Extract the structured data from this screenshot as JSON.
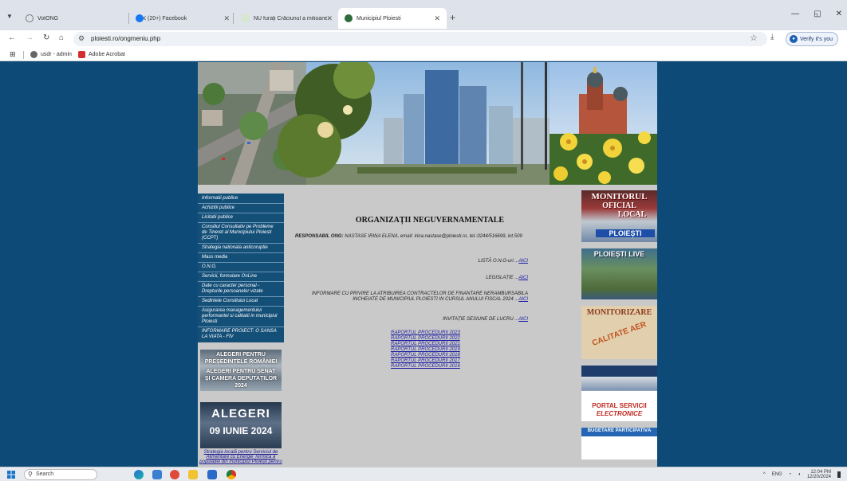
{
  "browser": {
    "tabs": [
      {
        "title": "VotONG",
        "active": false
      },
      {
        "title": "(20+) Facebook",
        "active": false
      },
      {
        "title": "NU furați Crăciunul a milioane",
        "active": false
      },
      {
        "title": "Municipiul Ploiesti",
        "active": true
      }
    ],
    "new_tab_label": "+",
    "url": "ploiesti.ro/ongmeniu.php",
    "verify_label": "Verify it's you",
    "bookmarks": [
      {
        "label": "usdr - admin"
      },
      {
        "label": "Adobe Acrobat"
      }
    ]
  },
  "site": {
    "menu": [
      "Informatii publice",
      "Achizitii publice",
      "Licitatii publice",
      "Consiliul Consultativ pe Probleme de Tineret al Municipiului Ploiesti (CCPT)",
      "Strategia nationala anticoruptie",
      "Mass media",
      "O.N.G.",
      "Servicii, formulare OnLine",
      "Date cu caracter personal - Drepturile persoanelor vizate",
      "Sedintele Consiliului Local",
      "Asigurarea managementului performantei si calitatii in municipiul Ploiesti",
      "INFORMARE PROIECT: O SANSA LA VIATA - FIV"
    ],
    "alegeri_banner": {
      "line1": "ALEGERI PENTRU",
      "line2": "PREȘEDINTELE ROMÂNIEI",
      "line3": "ALEGERI PENTRU SENAT",
      "line4": "ȘI CAMERA DEPUTAȚILOR",
      "line5": "2024"
    },
    "alegeri_iunie": {
      "line1": "ALEGERI",
      "line2": "09 IUNIE 2024"
    },
    "strategie_link": "Strategia locală pentru Serviciul de Alimentare cu Energie Termică a populației din municipiul Ploiești pentru",
    "title": "ORGANIZAȚII NEGUVERNAMENTALE",
    "responsabil_label": "RESPONSABIL ONG:",
    "responsabil_text": "NASTASE IRINA ELENA, email: irina.nastase@ploiesti.ro, tel.:0244/516699, int.509",
    "lines": [
      {
        "text": "LISTĂ O.N.G-uri ...",
        "link": "AICI"
      },
      {
        "text": "LEGISLAȚIE ...",
        "link": "AICI"
      },
      {
        "text": "INFORMARE CU PRIVIRE LA ATRIBUIREA CONTRACTELOR DE FINANTARE NERAMBURSABILA INCHEIATE DE MUNICIPIUL PLOIESTI IN CURSUL ANULUI FISCAL 2024 ...",
        "link": "AICI"
      },
      {
        "text": "INVITAȚIE SESIUNE DE LUCRU ...",
        "link": "AICI"
      }
    ],
    "reports": [
      "RAPORTUL PROCEDURII 2023",
      "RAPORTUL PROCEDURII 2022",
      "RAPORTUL PROCEDURII 2021",
      "RAPORTUL PROCEDURII 2019",
      "RAPORTUL PROCEDURII 2018",
      "RAPORTUL PROCEDURII 2017",
      "RAPORTUL PROCEDURII 2016"
    ],
    "right_banners": {
      "monitorul_1": "MONITORUL",
      "monitorul_2": "OFICIAL",
      "monitorul_3": "LOCAL",
      "monitorul_4": "PLOIEȘTI",
      "live": "PLOIEȘTI LIVE",
      "monitorizare": "MONITORIZARE",
      "calitate": "CALITATE AER",
      "portal_1": "PORTAL SERVICII",
      "portal_2": "ELECTRONICE",
      "bugetare": "BUGETARE PARTICIPATIVĂ"
    }
  },
  "taskbar": {
    "search_placeholder": "Search",
    "lang": "ENG",
    "time": "12:04 PM",
    "date": "12/20/2024"
  },
  "colors": {
    "page_bg": "#0d4a78",
    "menu_bg": "#144f78",
    "site_bg": "#c9c9c9",
    "link": "#1a1aa0"
  }
}
